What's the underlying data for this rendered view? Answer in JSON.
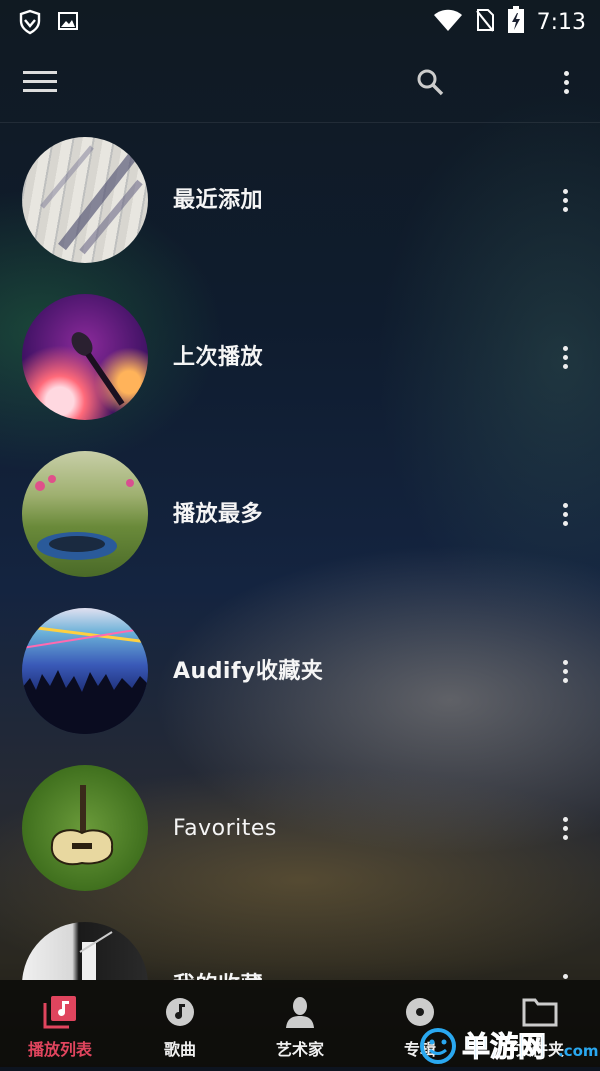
{
  "status_bar": {
    "time": "7:13",
    "icons": [
      "shield-icon",
      "image-icon",
      "wifi-icon",
      "no-sim-icon",
      "battery-charging-icon"
    ]
  },
  "toolbar": {
    "icons": [
      "menu-icon",
      "search-icon",
      "more-vert-icon"
    ]
  },
  "playlists": [
    {
      "label": "最近添加",
      "thumb": "sheet-music-lavender"
    },
    {
      "label": "上次播放",
      "thumb": "microphone-stage"
    },
    {
      "label": "播放最多",
      "thumb": "headphones-grass"
    },
    {
      "label": "Audify收藏夹",
      "thumb": "concert-crowd"
    },
    {
      "label": "Favorites",
      "thumb": "guitar-grass"
    },
    {
      "label": "我的收藏",
      "thumb": "guitar-closeup"
    }
  ],
  "bottom_nav": [
    {
      "label": "播放列表",
      "icon": "playlist-icon",
      "active": true
    },
    {
      "label": "歌曲",
      "icon": "music-disc-icon",
      "active": false
    },
    {
      "label": "艺术家",
      "icon": "artist-icon",
      "active": false
    },
    {
      "label": "专辑",
      "icon": "album-icon",
      "active": false
    },
    {
      "label": "文件夹",
      "icon": "folder-icon",
      "active": false
    }
  ],
  "watermark": {
    "text": "单游网",
    "suffix": ".com"
  },
  "colors": {
    "accent": "#e0455e",
    "watermark": "#2aa8f0"
  }
}
